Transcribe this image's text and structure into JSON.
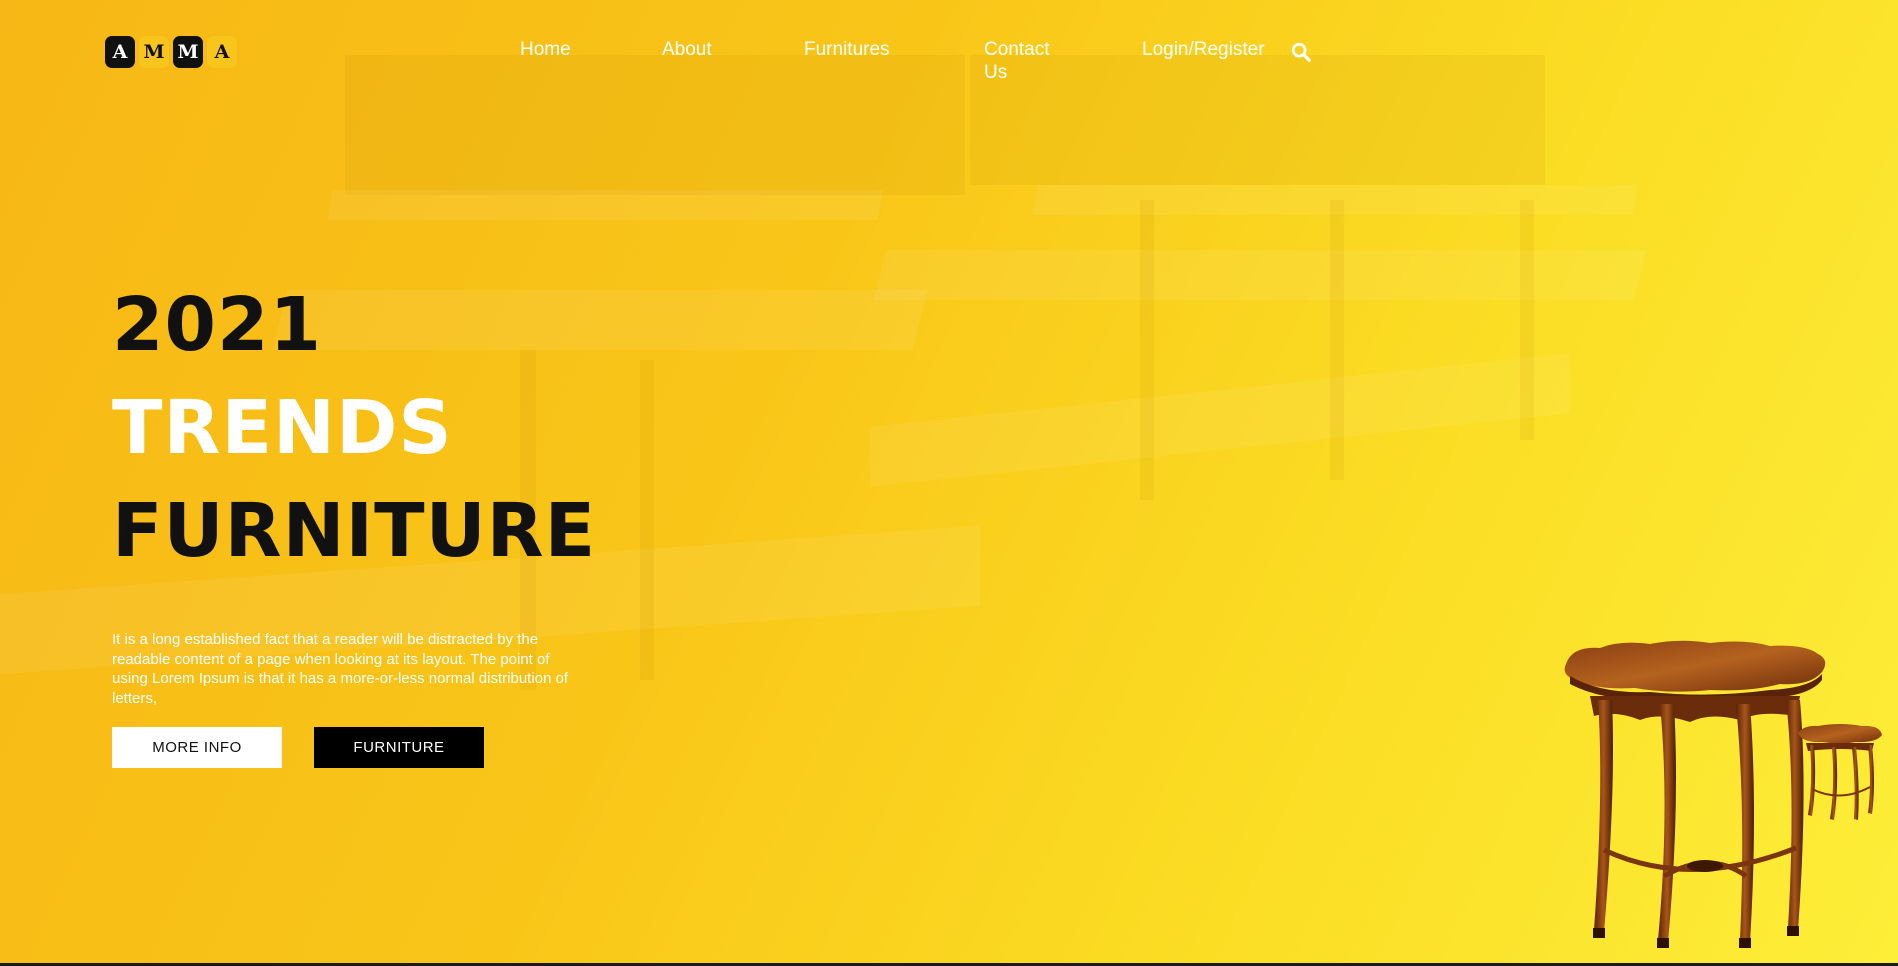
{
  "logo": {
    "letters": [
      "A",
      "M",
      "M",
      "A"
    ]
  },
  "nav": {
    "home": "Home",
    "about": "About",
    "furnitures": "Furnitures",
    "contact": "Contact Us",
    "login": "Login/Register",
    "search_icon": "search-icon"
  },
  "hero": {
    "line1": "2021",
    "line2": "TRENDS",
    "line3": "FURNITURE",
    "description": "It is a long established fact that a reader will be distracted by the readable content of a page when looking at its layout. The point of using Lorem Ipsum is that it has a more-or-less normal distribution of letters,",
    "more_info_label": "MORE INFO",
    "furniture_label": "FURNITURE"
  },
  "colors": {
    "accent_yellow": "#f9c618",
    "dark": "#111111",
    "white": "#ffffff"
  }
}
